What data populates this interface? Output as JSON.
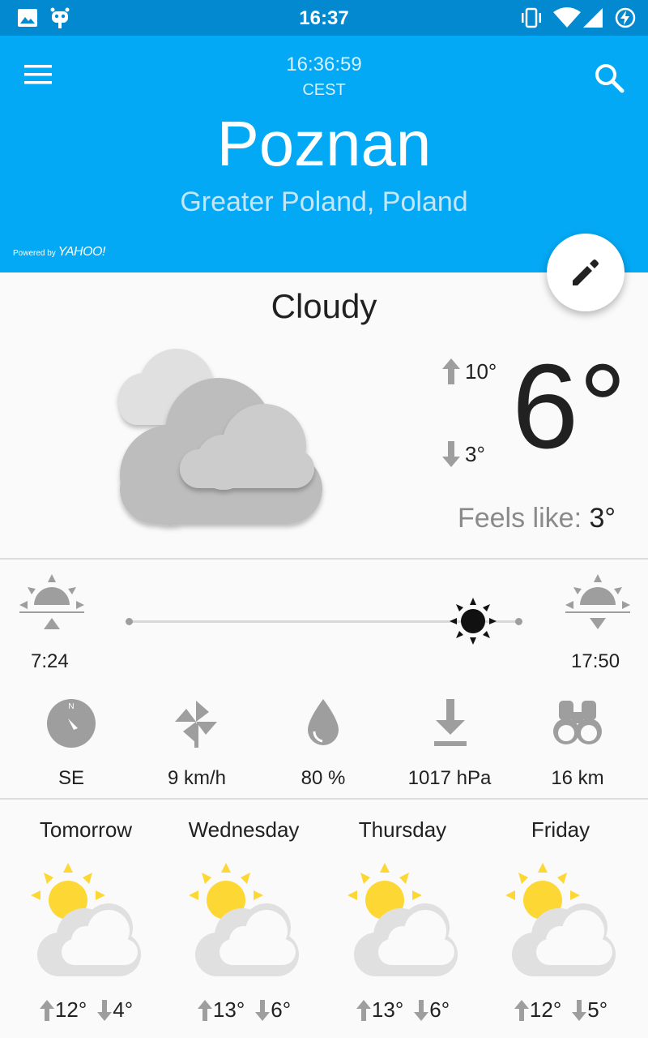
{
  "status_bar": {
    "time": "16:37",
    "left_icons": [
      "image-icon",
      "cyanogen-bot-icon"
    ],
    "right_icons": [
      "vibrate-icon",
      "wifi-icon",
      "signal-icon",
      "battery-charging-icon"
    ]
  },
  "header": {
    "local_time": "16:36:59",
    "timezone": "CEST",
    "city": "Poznan",
    "region": "Greater Poland, Poland",
    "powered_by": "Powered by",
    "provider": "YAHOO!",
    "menu_icon": "menu-icon",
    "search_icon": "search-icon",
    "edit_icon": "pencil-icon"
  },
  "current": {
    "condition": "Cloudy",
    "high": "10°",
    "low": "3°",
    "temperature": "6°",
    "feels_like_label": "Feels like:",
    "feels_like_value": "3°"
  },
  "sun": {
    "sunrise": "7:24",
    "sunset": "17:50",
    "day_progress": 0.89
  },
  "details": [
    {
      "icon": "compass-icon",
      "value": "SE"
    },
    {
      "icon": "windmill-icon",
      "value": "9 km/h"
    },
    {
      "icon": "humidity-drop-icon",
      "value": "80 %"
    },
    {
      "icon": "pressure-icon",
      "value": "1017 hPa"
    },
    {
      "icon": "binoculars-icon",
      "value": "16 km"
    }
  ],
  "forecast": [
    {
      "day": "Tomorrow",
      "high": "12°",
      "low": "4°",
      "icon": "partly-cloudy-icon"
    },
    {
      "day": "Wednesday",
      "high": "13°",
      "low": "6°",
      "icon": "partly-cloudy-icon"
    },
    {
      "day": "Thursday",
      "high": "13°",
      "low": "6°",
      "icon": "partly-cloudy-icon"
    },
    {
      "day": "Friday",
      "high": "12°",
      "low": "5°",
      "icon": "partly-cloudy-icon"
    }
  ],
  "colors": {
    "status_bar": "#0289cf",
    "header": "#03a9f4",
    "sun_yellow": "#fdd835",
    "icon_grey": "#9e9e9e"
  }
}
